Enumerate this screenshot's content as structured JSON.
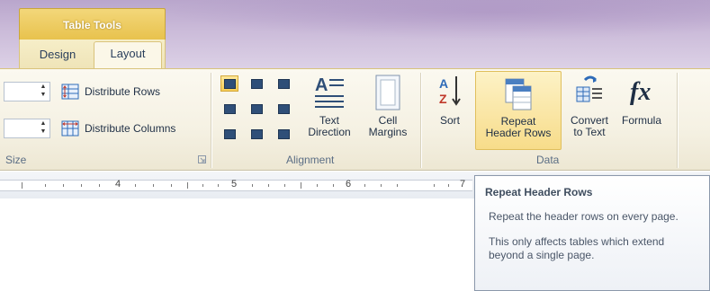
{
  "contextual_tab": {
    "title": "Table Tools"
  },
  "tabs": [
    {
      "label": "Design",
      "active": false
    },
    {
      "label": "Layout",
      "active": true
    }
  ],
  "groups": {
    "cell_size": {
      "label": "Size",
      "distribute_rows": "Distribute Rows",
      "distribute_columns": "Distribute Columns"
    },
    "alignment": {
      "label": "Alignment",
      "text_direction": [
        "Text",
        "Direction"
      ],
      "cell_margins": [
        "Cell",
        "Margins"
      ]
    },
    "data": {
      "label": "Data",
      "sort": "Sort",
      "repeat_header_rows": [
        "Repeat",
        "Header Rows"
      ],
      "convert_to_text": [
        "Convert",
        "to Text"
      ],
      "formula": "Formula"
    }
  },
  "ruler": {
    "numbers": [
      "4",
      "5",
      "6",
      "7"
    ]
  },
  "tooltip": {
    "title": "Repeat Header Rows",
    "line1": "Repeat the header rows on every page.",
    "line2": "This only affects tables which extend beyond a single page."
  },
  "colors": {
    "accent": "#f7dc8a",
    "contextual": "#e8c24d",
    "title_band": "#cbbbd9"
  },
  "icons": [
    "spin-up-down-icon",
    "distribute-rows-icon",
    "distribute-columns-icon",
    "align-icon",
    "text-direction-icon",
    "cell-margins-icon",
    "sort-az-icon",
    "repeat-header-rows-icon",
    "convert-to-text-icon",
    "formula-fx-icon",
    "dialog-launcher-icon"
  ]
}
